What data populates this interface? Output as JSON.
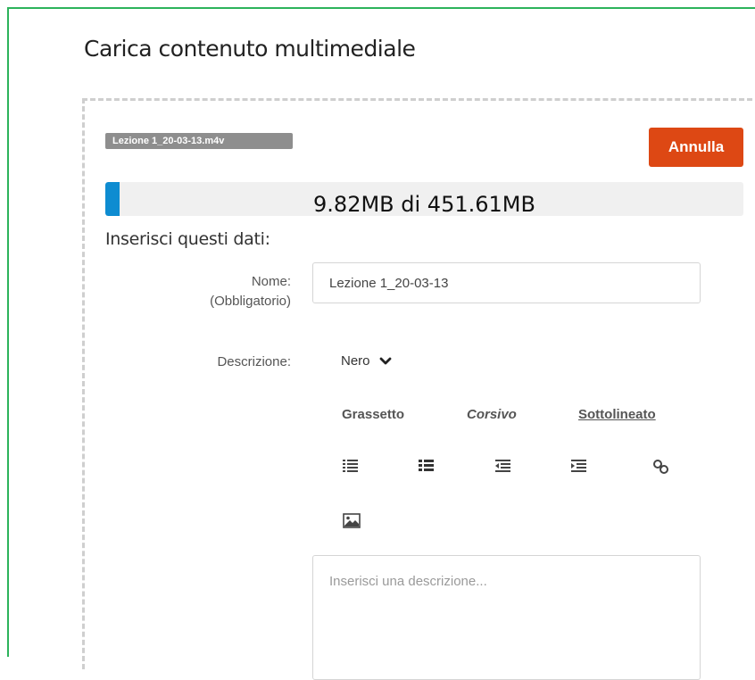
{
  "page": {
    "title": "Carica contenuto multimediale"
  },
  "upload": {
    "file_name": "Lezione 1_20-03-13.m4v",
    "cancel_label": "Annulla",
    "progress_text": "9.82MB di 451.61MB",
    "progress_fraction": 0.0217
  },
  "form": {
    "heading": "Inserisci questi dati:",
    "name_label": "Nome:",
    "name_required": "(Obbligatorio)",
    "name_value": "Lezione 1_20-03-13",
    "description_label": "Descrizione:",
    "description_placeholder": "Inserisci una descrizione..."
  },
  "editor": {
    "color_value": "Nero",
    "bold_label": "Grassetto",
    "italic_label": "Corsivo",
    "underline_label": "Sottolineato",
    "toolbar_icons": [
      "ordered-list-icon",
      "unordered-list-icon",
      "outdent-icon",
      "indent-icon",
      "link-icon",
      "image-icon"
    ]
  },
  "colors": {
    "frame_border": "#2db35b",
    "cancel_button": "#dd4814",
    "progress_fill": "#0e8cd1",
    "file_badge": "#8e8e8e"
  }
}
